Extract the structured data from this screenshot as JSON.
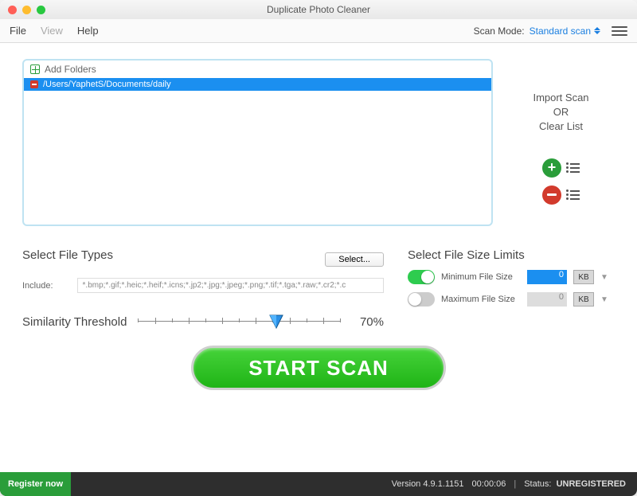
{
  "window": {
    "title": "Duplicate Photo Cleaner"
  },
  "menubar": {
    "file": "File",
    "view": "View",
    "help": "Help",
    "scan_mode_label": "Scan Mode:",
    "scan_mode_value": "Standard scan"
  },
  "folders": {
    "add_label": "Add Folders",
    "items": [
      "/Users/YaphetS/Documents/daily"
    ]
  },
  "side": {
    "line1": "Import Scan",
    "line2": "OR",
    "line3": "Clear List"
  },
  "filetypes": {
    "title": "Select File Types",
    "select_btn": "Select...",
    "include_label": "Include:",
    "include_value": "*.bmp;*.gif;*.heic;*.heif;*.icns;*.jp2;*.jpg;*.jpeg;*.png;*.tif;*.tga;*.raw;*.cr2;*.c"
  },
  "similarity": {
    "label": "Similarity Threshold",
    "value": "70%"
  },
  "filesize": {
    "title": "Select File Size Limits",
    "min_label": "Minimum File Size",
    "max_label": "Maximum File Size",
    "min_value": "0",
    "max_value": "0",
    "unit": "KB"
  },
  "start": {
    "label": "START SCAN"
  },
  "status": {
    "register": "Register now",
    "version": "Version 4.9.1.1151",
    "time": "00:00:06",
    "status_label": "Status:",
    "status_value": "UNREGISTERED"
  }
}
